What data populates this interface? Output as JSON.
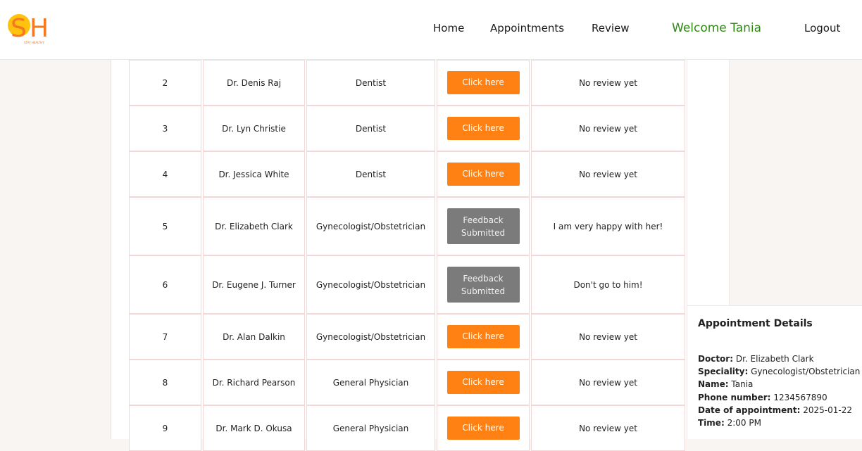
{
  "nav": {
    "logo_letters": "SH",
    "logo_tagline": "STAY HEALTHY",
    "home": "Home",
    "appointments": "Appointments",
    "review": "Review",
    "welcome": "Welcome Tania",
    "logout": "Logout"
  },
  "table": {
    "rows": [
      {
        "no": "2",
        "doctor": "Dr. Denis Raj",
        "speciality": "Dentist",
        "feedback": "Click here",
        "submitted": false,
        "review": "No review yet"
      },
      {
        "no": "3",
        "doctor": "Dr. Lyn Christie",
        "speciality": "Dentist",
        "feedback": "Click here",
        "submitted": false,
        "review": "No review yet"
      },
      {
        "no": "4",
        "doctor": "Dr. Jessica White",
        "speciality": "Dentist",
        "feedback": "Click here",
        "submitted": false,
        "review": "No review yet"
      },
      {
        "no": "5",
        "doctor": "Dr. Elizabeth Clark",
        "speciality": "Gynecologist/Obstetrician",
        "feedback": "Feedback\nSubmitted",
        "submitted": true,
        "review": "I am very happy with her!"
      },
      {
        "no": "6",
        "doctor": "Dr. Eugene J. Turner",
        "speciality": "Gynecologist/Obstetrician",
        "feedback": "Feedback\nSubmitted",
        "submitted": true,
        "review": "Don't go to him!"
      },
      {
        "no": "7",
        "doctor": "Dr. Alan Dalkin",
        "speciality": "Gynecologist/Obstetrician",
        "feedback": "Click here",
        "submitted": false,
        "review": "No review yet"
      },
      {
        "no": "8",
        "doctor": "Dr. Richard Pearson",
        "speciality": "General Physician",
        "feedback": "Click here",
        "submitted": false,
        "review": "No review yet"
      },
      {
        "no": "9",
        "doctor": "Dr. Mark D. Okusa",
        "speciality": "General Physician",
        "feedback": "Click here",
        "submitted": false,
        "review": "No review yet"
      }
    ]
  },
  "appointment": {
    "title": "Appointment Details",
    "doctor_label": "Doctor:",
    "doctor": "Dr. Elizabeth Clark",
    "speciality_label": "Speciality:",
    "speciality": "Gynecologist/Obstetrician",
    "name_label": "Name:",
    "name": "Tania",
    "phone_label": "Phone number:",
    "phone": "1234567890",
    "date_label": "Date of appointment:",
    "date": "2025-01-22",
    "time_label": "Time:",
    "time": "2:00 PM"
  },
  "colors": {
    "accent": "#ff8114",
    "submitted": "#7b7b7b",
    "welcome": "#2e8a14",
    "logo_orange": "#f47920",
    "logo_yellow": "#ffc20e"
  }
}
